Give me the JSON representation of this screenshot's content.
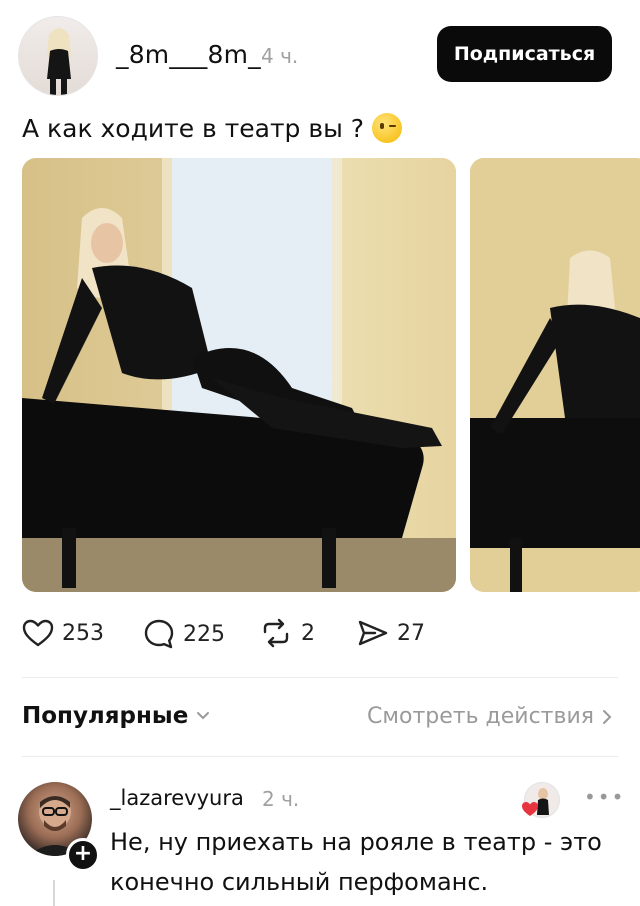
{
  "post": {
    "username": "_8m___8m_",
    "time": "4 ч.",
    "follow_label": "Подписаться",
    "text": "А как ходите в театр вы ?",
    "emoji_icon": "winking-face-emoji"
  },
  "actions": {
    "likes": "253",
    "comments": "225",
    "reposts": "2",
    "shares": "27"
  },
  "sort": {
    "label": "Популярные",
    "view_actions": "Смотреть действия"
  },
  "comment": {
    "username": "_lazarevyura",
    "time": "2 ч.",
    "text": "Не, ну приехать на рояле в театр - это конечно сильный перфоманс."
  },
  "colors": {
    "follow_bg": "#0a0a0a",
    "muted": "#a0a0a0",
    "heart_red": "#e8343f"
  }
}
